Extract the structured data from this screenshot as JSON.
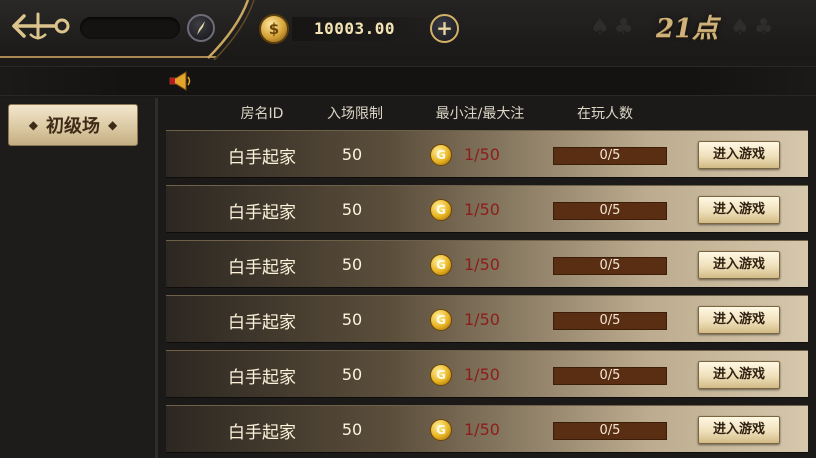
{
  "topbar": {
    "gold_amount": "10003.00",
    "coin_symbol": "$",
    "plus_label": "+",
    "game_title": "21点"
  },
  "sidebar": {
    "level_label": "初级场"
  },
  "columns": {
    "room_id": "房名ID",
    "entry_limit": "入场限制",
    "bet_range": "最小注/最大注",
    "players": "在玩人数"
  },
  "rooms": [
    {
      "name": "白手起家",
      "limit": "50",
      "bet": "1/50",
      "players": "0/5",
      "enter": "进入游戏",
      "coin": "G"
    },
    {
      "name": "白手起家",
      "limit": "50",
      "bet": "1/50",
      "players": "0/5",
      "enter": "进入游戏",
      "coin": "G"
    },
    {
      "name": "白手起家",
      "limit": "50",
      "bet": "1/50",
      "players": "0/5",
      "enter": "进入游戏",
      "coin": "G"
    },
    {
      "name": "白手起家",
      "limit": "50",
      "bet": "1/50",
      "players": "0/5",
      "enter": "进入游戏",
      "coin": "G"
    },
    {
      "name": "白手起家",
      "limit": "50",
      "bet": "1/50",
      "players": "0/5",
      "enter": "进入游戏",
      "coin": "G"
    },
    {
      "name": "白手起家",
      "limit": "50",
      "bet": "1/50",
      "players": "0/5",
      "enter": "进入游戏",
      "coin": "G"
    }
  ],
  "icons": {
    "back": "anchor-back-icon",
    "compass": "compass-icon",
    "coin": "gold-coin-icon",
    "horn": "horn-icon"
  },
  "colors": {
    "gold_accent": "#cfb27a",
    "bet_red": "#8b1e1a",
    "player_bar": "#5a2e13"
  }
}
